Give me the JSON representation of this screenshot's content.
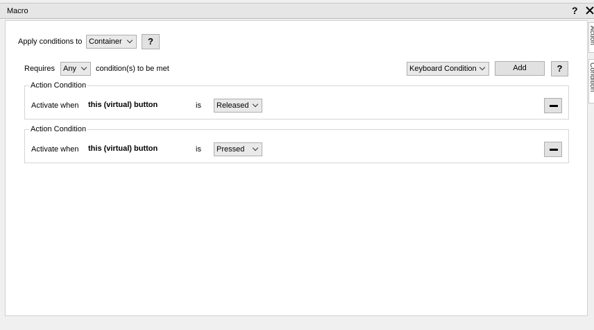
{
  "window": {
    "title": "Macro",
    "help_label": "?"
  },
  "side_tabs": [
    "Action",
    "Condition"
  ],
  "apply": {
    "label": "Apply conditions to",
    "value": "Container",
    "help_label": "?"
  },
  "requires": {
    "label": "Requires",
    "value": "Any",
    "suffix": "condition(s) to be met"
  },
  "add_condition": {
    "type_value": "Keyboard Condition",
    "add_label": "Add",
    "help_label": "?"
  },
  "conditions": [
    {
      "title": "Action Condition",
      "activate_label": "Activate when",
      "target": "this (virtual) button",
      "is_label": "is",
      "state": "Released"
    },
    {
      "title": "Action Condition",
      "activate_label": "Activate when",
      "target": "this (virtual) button",
      "is_label": "is",
      "state": "Pressed"
    }
  ]
}
